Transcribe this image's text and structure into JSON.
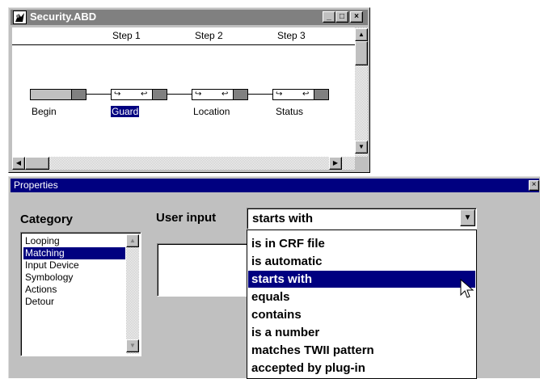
{
  "security_window": {
    "title": "Security.ABD",
    "steps": [
      "Step 1",
      "Step 2",
      "Step 3"
    ],
    "nodes": [
      {
        "label": "Begin",
        "selected": false
      },
      {
        "label": "Guard",
        "selected": true
      },
      {
        "label": "Location",
        "selected": false
      },
      {
        "label": "Status",
        "selected": false
      }
    ]
  },
  "properties_window": {
    "title": "Properties",
    "category_heading": "Category",
    "user_input_heading": "User input",
    "category_items": [
      "Looping",
      "Matching",
      "Input Device",
      "Symbology",
      "Actions",
      "Detour"
    ],
    "selected_category": "Matching",
    "user_input_value": "starts with",
    "user_input_options": [
      "is in CRF file",
      "is automatic",
      "starts with",
      "equals",
      "contains",
      "is a number",
      "matches TWII pattern",
      "accepted by plug-in"
    ],
    "highlighted_option": "starts with"
  },
  "colors": {
    "selection": "#000080",
    "face": "#c0c0c0",
    "inactive_title": "#808080"
  }
}
